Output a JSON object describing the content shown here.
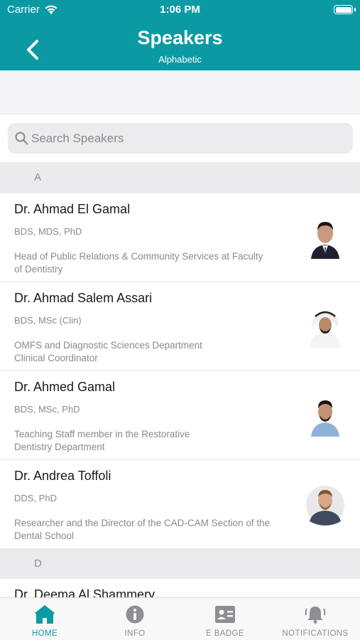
{
  "status_bar": {
    "carrier": "Carrier",
    "time": "1:06 PM"
  },
  "header": {
    "title": "Speakers",
    "subtitle": "Alphabetic"
  },
  "search": {
    "placeholder": "Search Speakers",
    "value": ""
  },
  "sections": [
    {
      "letter": "A",
      "speakers": [
        {
          "name": "Dr. Ahmad El Gamal",
          "degrees": "BDS, MDS, PhD",
          "title_line1": "Head of Public Relations & Community Services at Faculty",
          "title_line2": "of Dentistry"
        },
        {
          "name": "Dr. Ahmad Salem Assari",
          "degrees": "BDS, MSc (Clin)",
          "title_line1": "OMFS and Diagnostic Sciences Department",
          "title_line2": "Clinical Coordinator"
        },
        {
          "name": "Dr. Ahmed Gamal",
          "degrees": "BDS, MSc, PhD",
          "title_line1": "Teaching Staff member in the Restorative",
          "title_line2": "Dentistry Department"
        },
        {
          "name": "Dr. Andrea Toffoli",
          "degrees": "DDS, PhD",
          "title_line1": "Researcher and the Director of the CAD-CAM Section of the",
          "title_line2": "Dental School"
        }
      ]
    },
    {
      "letter": "D",
      "speakers": [
        {
          "name": "Dr. Deema Al Shammery"
        }
      ]
    }
  ],
  "tabs": [
    {
      "label": "HOME",
      "icon": "home-icon",
      "active": true
    },
    {
      "label": "INFO",
      "icon": "info-icon",
      "active": false
    },
    {
      "label": "E BADGE",
      "icon": "badge-icon",
      "active": false
    },
    {
      "label": "NOTIFICATIONS",
      "icon": "bell-icon",
      "active": false
    }
  ],
  "colors": {
    "accent": "#0b9aa3",
    "inactive_tab": "#8e8e93",
    "section_bg": "#ebebed"
  }
}
